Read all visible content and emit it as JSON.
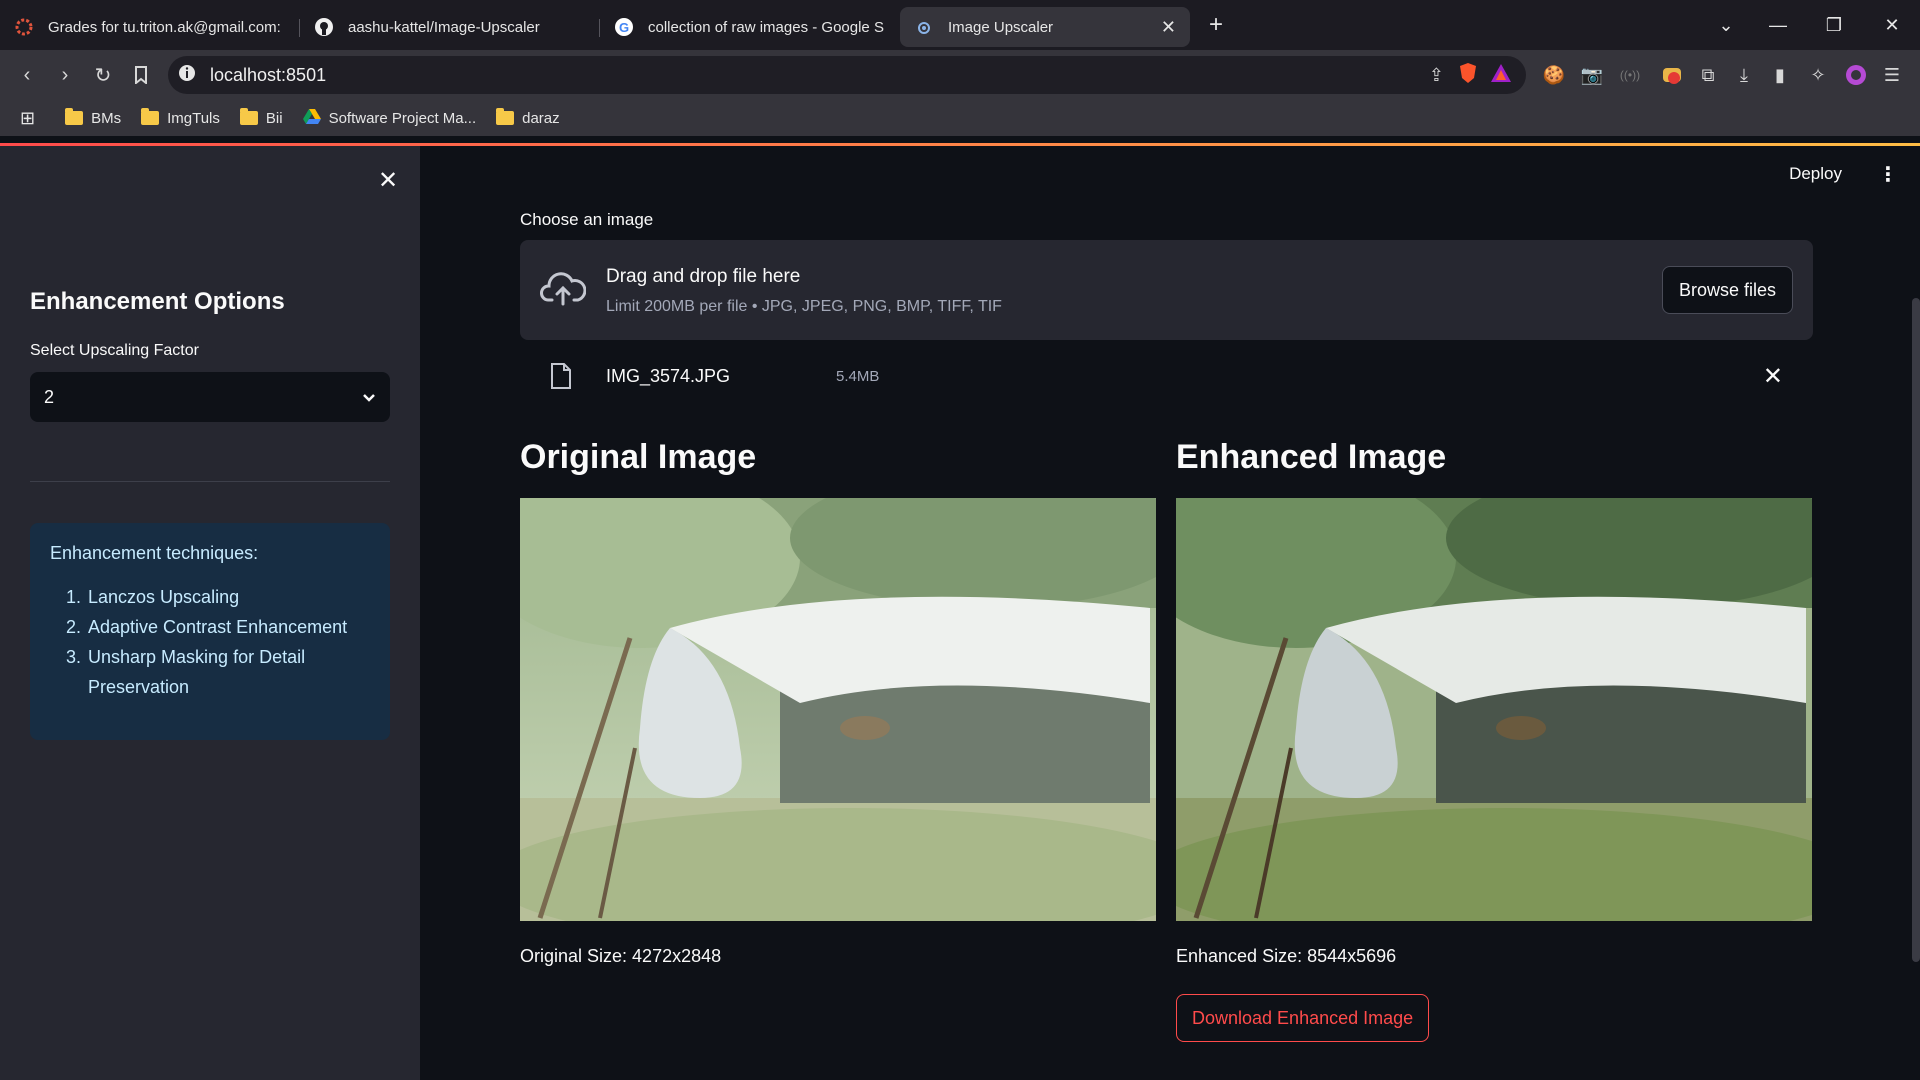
{
  "browser": {
    "tabs": [
      {
        "title": "Grades for tu.triton.ak@gmail.com:"
      },
      {
        "title": "aashu-kattel/Image-Upscaler"
      },
      {
        "title": "collection of raw images - Google S"
      },
      {
        "title": "Image Upscaler"
      }
    ],
    "url": "localhost:8501",
    "bookmarks": [
      {
        "label": "BMs"
      },
      {
        "label": "ImgTuls"
      },
      {
        "label": "Bii"
      },
      {
        "label": "Software Project Ma..."
      },
      {
        "label": "daraz"
      }
    ]
  },
  "app": {
    "deploy_label": "Deploy",
    "sidebar": {
      "title": "Enhancement Options",
      "select_label": "Select Upscaling Factor",
      "select_value": "2",
      "info_title": "Enhancement techniques:",
      "techniques": [
        {
          "num": "1.",
          "text": "Lanczos Upscaling"
        },
        {
          "num": "2.",
          "text": "Adaptive Contrast Enhancement"
        },
        {
          "num": "3.",
          "text": "Unsharp Masking for Detail Preservation"
        }
      ]
    },
    "uploader": {
      "label": "Choose an image",
      "drop_text": "Drag and drop file here",
      "limit_text": "Limit 200MB per file • JPG, JPEG, PNG, BMP, TIFF, TIF",
      "browse_label": "Browse files",
      "file_name": "IMG_3574.JPG",
      "file_size": "5.4MB"
    },
    "original": {
      "title": "Original Image",
      "caption": "Original Size: 4272x2848"
    },
    "enhanced": {
      "title": "Enhanced Image",
      "caption": "Enhanced Size: 8544x5696",
      "download_label": "Download Enhanced Image"
    }
  }
}
